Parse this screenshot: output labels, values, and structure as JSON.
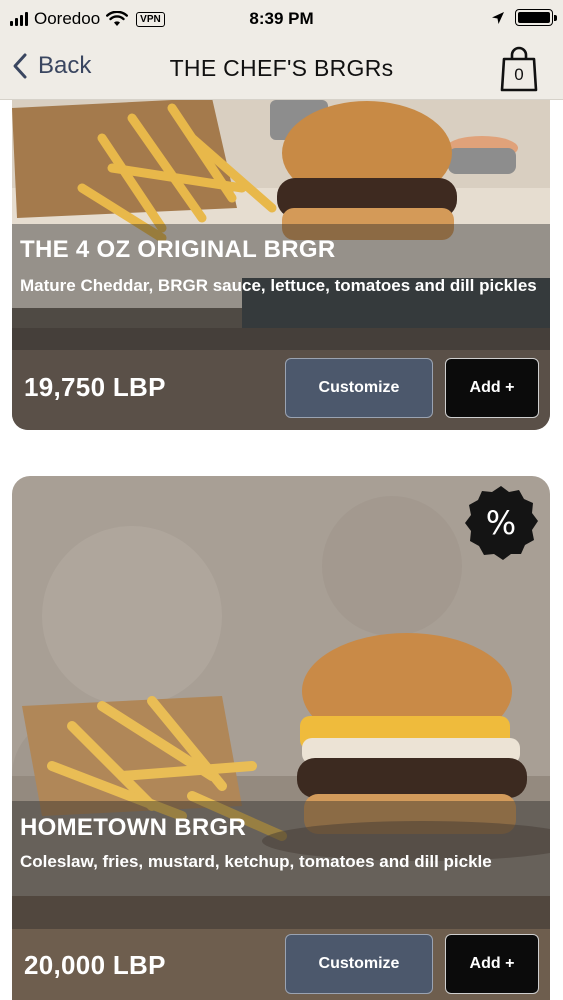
{
  "status_bar": {
    "carrier": "Ooredoo",
    "vpn": "VPN",
    "time": "8:39 PM",
    "icons": [
      "signal-icon",
      "wifi-icon",
      "location-arrow-icon",
      "battery-icon"
    ]
  },
  "nav": {
    "back_label": "Back",
    "title": "THE CHEF'S BRGRs",
    "cart_count": "0",
    "accent_color": "#3a4660"
  },
  "products": [
    {
      "name": "THE 4 OZ ORIGINAL BRGR",
      "description": "Mature Cheddar, BRGR sauce, lettuce, tomatoes and dill pickles",
      "price": "19,750 LBP",
      "customize_label": "Customize",
      "add_label": "Add +"
    },
    {
      "name": "HOMETOWN BRGR",
      "description": "Coleslaw, fries, mustard, ketchup, tomatoes and dill pickle",
      "price": "20,000 LBP",
      "customize_label": "Customize",
      "add_label": "Add +",
      "discount_badge": "%"
    }
  ],
  "colors": {
    "customize_button": "#4c586c",
    "add_button": "#0b0b0b",
    "nav_background": "#efece6"
  }
}
